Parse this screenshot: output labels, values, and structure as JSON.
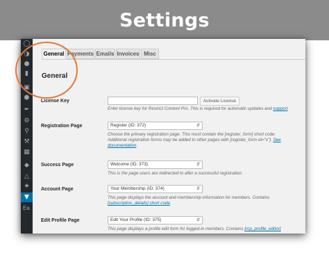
{
  "banner": {
    "title": "Settings"
  },
  "tabs": [
    {
      "label": "General",
      "active": true
    },
    {
      "label": "Payments",
      "active": false
    },
    {
      "label": "Emails",
      "active": false
    },
    {
      "label": "Invoices",
      "active": false
    },
    {
      "label": "Misc",
      "active": false
    }
  ],
  "section": {
    "heading": "General"
  },
  "sidebar": {
    "icons": [
      "wordpress-icon",
      "palette-icon",
      "pin-icon",
      "comment-icon",
      "media-icon",
      "rcp-icon",
      "appearance-icon",
      "plugins-icon",
      "users-icon",
      "tools-icon",
      "settings-icon",
      "shield-icon",
      "network-icon",
      "star-icon"
    ],
    "active_icon": "lock-icon",
    "label_fragment": "Ea"
  },
  "license": {
    "label": "License Key",
    "value": "",
    "button": "Activate License",
    "desc_before": "Enter license key for Restrict Content Pro. This is required for automatic updates and ",
    "desc_link": "support",
    "desc_after": "."
  },
  "registration": {
    "label": "Registration Page",
    "selected": "Register (ID: 372)",
    "line1": "Choose the primary registration page. This must contain the [register_form] short code.",
    "line2": "Additional registration forms may be added to other pages with [register_form id=\"x\"]. ",
    "line2_link": "See",
    "line3_link": "documentation",
    "line3_after": "."
  },
  "success": {
    "label": "Success Page",
    "selected": "Welcome (ID: 373)",
    "line1": "This is the page users are redirected to after a successful registration."
  },
  "account": {
    "label": "Account Page",
    "selected": "Your Membership (ID: 374)",
    "line1": "This page displays the account and membership information for members. Contains",
    "line2_link": "[subscription_details] short code",
    "line2_after": "."
  },
  "profile": {
    "label": "Edit Profile Page",
    "selected": "Edit Your Profile (ID: 375)",
    "line1_before": "This page displays a profile edit form for logged-in members. Contains ",
    "line1_link": "[rcp_profile_editor]"
  },
  "colors": {
    "accent": "#0073aa",
    "highlight": "#e07a35",
    "sidebar": "#23282d",
    "banner": "#8b8b8b"
  }
}
